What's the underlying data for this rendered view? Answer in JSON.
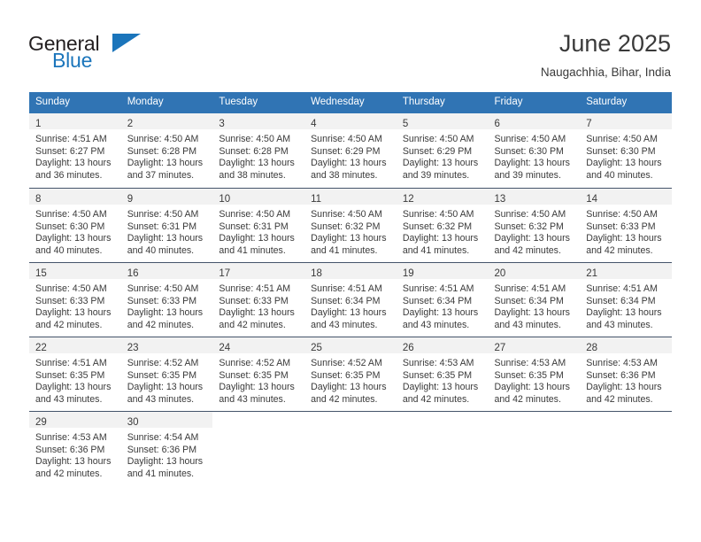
{
  "brand": {
    "name_part1": "General",
    "name_part2": "Blue",
    "accent_color": "#1b75bb"
  },
  "header": {
    "title": "June 2025",
    "subtitle": "Naugachhia, Bihar, India"
  },
  "theme": {
    "header_blue": "#3074b4",
    "day_band_gray": "#f2f2f2",
    "rule_color": "#44546a",
    "text_color": "#3a3a3a"
  },
  "calendar": {
    "columns": [
      "Sunday",
      "Monday",
      "Tuesday",
      "Wednesday",
      "Thursday",
      "Friday",
      "Saturday"
    ],
    "weeks": [
      [
        {
          "day": "1",
          "sunrise": "Sunrise: 4:51 AM",
          "sunset": "Sunset: 6:27 PM",
          "daylight1": "Daylight: 13 hours",
          "daylight2": "and 36 minutes."
        },
        {
          "day": "2",
          "sunrise": "Sunrise: 4:50 AM",
          "sunset": "Sunset: 6:28 PM",
          "daylight1": "Daylight: 13 hours",
          "daylight2": "and 37 minutes."
        },
        {
          "day": "3",
          "sunrise": "Sunrise: 4:50 AM",
          "sunset": "Sunset: 6:28 PM",
          "daylight1": "Daylight: 13 hours",
          "daylight2": "and 38 minutes."
        },
        {
          "day": "4",
          "sunrise": "Sunrise: 4:50 AM",
          "sunset": "Sunset: 6:29 PM",
          "daylight1": "Daylight: 13 hours",
          "daylight2": "and 38 minutes."
        },
        {
          "day": "5",
          "sunrise": "Sunrise: 4:50 AM",
          "sunset": "Sunset: 6:29 PM",
          "daylight1": "Daylight: 13 hours",
          "daylight2": "and 39 minutes."
        },
        {
          "day": "6",
          "sunrise": "Sunrise: 4:50 AM",
          "sunset": "Sunset: 6:30 PM",
          "daylight1": "Daylight: 13 hours",
          "daylight2": "and 39 minutes."
        },
        {
          "day": "7",
          "sunrise": "Sunrise: 4:50 AM",
          "sunset": "Sunset: 6:30 PM",
          "daylight1": "Daylight: 13 hours",
          "daylight2": "and 40 minutes."
        }
      ],
      [
        {
          "day": "8",
          "sunrise": "Sunrise: 4:50 AM",
          "sunset": "Sunset: 6:30 PM",
          "daylight1": "Daylight: 13 hours",
          "daylight2": "and 40 minutes."
        },
        {
          "day": "9",
          "sunrise": "Sunrise: 4:50 AM",
          "sunset": "Sunset: 6:31 PM",
          "daylight1": "Daylight: 13 hours",
          "daylight2": "and 40 minutes."
        },
        {
          "day": "10",
          "sunrise": "Sunrise: 4:50 AM",
          "sunset": "Sunset: 6:31 PM",
          "daylight1": "Daylight: 13 hours",
          "daylight2": "and 41 minutes."
        },
        {
          "day": "11",
          "sunrise": "Sunrise: 4:50 AM",
          "sunset": "Sunset: 6:32 PM",
          "daylight1": "Daylight: 13 hours",
          "daylight2": "and 41 minutes."
        },
        {
          "day": "12",
          "sunrise": "Sunrise: 4:50 AM",
          "sunset": "Sunset: 6:32 PM",
          "daylight1": "Daylight: 13 hours",
          "daylight2": "and 41 minutes."
        },
        {
          "day": "13",
          "sunrise": "Sunrise: 4:50 AM",
          "sunset": "Sunset: 6:32 PM",
          "daylight1": "Daylight: 13 hours",
          "daylight2": "and 42 minutes."
        },
        {
          "day": "14",
          "sunrise": "Sunrise: 4:50 AM",
          "sunset": "Sunset: 6:33 PM",
          "daylight1": "Daylight: 13 hours",
          "daylight2": "and 42 minutes."
        }
      ],
      [
        {
          "day": "15",
          "sunrise": "Sunrise: 4:50 AM",
          "sunset": "Sunset: 6:33 PM",
          "daylight1": "Daylight: 13 hours",
          "daylight2": "and 42 minutes."
        },
        {
          "day": "16",
          "sunrise": "Sunrise: 4:50 AM",
          "sunset": "Sunset: 6:33 PM",
          "daylight1": "Daylight: 13 hours",
          "daylight2": "and 42 minutes."
        },
        {
          "day": "17",
          "sunrise": "Sunrise: 4:51 AM",
          "sunset": "Sunset: 6:33 PM",
          "daylight1": "Daylight: 13 hours",
          "daylight2": "and 42 minutes."
        },
        {
          "day": "18",
          "sunrise": "Sunrise: 4:51 AM",
          "sunset": "Sunset: 6:34 PM",
          "daylight1": "Daylight: 13 hours",
          "daylight2": "and 43 minutes."
        },
        {
          "day": "19",
          "sunrise": "Sunrise: 4:51 AM",
          "sunset": "Sunset: 6:34 PM",
          "daylight1": "Daylight: 13 hours",
          "daylight2": "and 43 minutes."
        },
        {
          "day": "20",
          "sunrise": "Sunrise: 4:51 AM",
          "sunset": "Sunset: 6:34 PM",
          "daylight1": "Daylight: 13 hours",
          "daylight2": "and 43 minutes."
        },
        {
          "day": "21",
          "sunrise": "Sunrise: 4:51 AM",
          "sunset": "Sunset: 6:34 PM",
          "daylight1": "Daylight: 13 hours",
          "daylight2": "and 43 minutes."
        }
      ],
      [
        {
          "day": "22",
          "sunrise": "Sunrise: 4:51 AM",
          "sunset": "Sunset: 6:35 PM",
          "daylight1": "Daylight: 13 hours",
          "daylight2": "and 43 minutes."
        },
        {
          "day": "23",
          "sunrise": "Sunrise: 4:52 AM",
          "sunset": "Sunset: 6:35 PM",
          "daylight1": "Daylight: 13 hours",
          "daylight2": "and 43 minutes."
        },
        {
          "day": "24",
          "sunrise": "Sunrise: 4:52 AM",
          "sunset": "Sunset: 6:35 PM",
          "daylight1": "Daylight: 13 hours",
          "daylight2": "and 43 minutes."
        },
        {
          "day": "25",
          "sunrise": "Sunrise: 4:52 AM",
          "sunset": "Sunset: 6:35 PM",
          "daylight1": "Daylight: 13 hours",
          "daylight2": "and 42 minutes."
        },
        {
          "day": "26",
          "sunrise": "Sunrise: 4:53 AM",
          "sunset": "Sunset: 6:35 PM",
          "daylight1": "Daylight: 13 hours",
          "daylight2": "and 42 minutes."
        },
        {
          "day": "27",
          "sunrise": "Sunrise: 4:53 AM",
          "sunset": "Sunset: 6:35 PM",
          "daylight1": "Daylight: 13 hours",
          "daylight2": "and 42 minutes."
        },
        {
          "day": "28",
          "sunrise": "Sunrise: 4:53 AM",
          "sunset": "Sunset: 6:36 PM",
          "daylight1": "Daylight: 13 hours",
          "daylight2": "and 42 minutes."
        }
      ],
      [
        {
          "day": "29",
          "sunrise": "Sunrise: 4:53 AM",
          "sunset": "Sunset: 6:36 PM",
          "daylight1": "Daylight: 13 hours",
          "daylight2": "and 42 minutes."
        },
        {
          "day": "30",
          "sunrise": "Sunrise: 4:54 AM",
          "sunset": "Sunset: 6:36 PM",
          "daylight1": "Daylight: 13 hours",
          "daylight2": "and 41 minutes."
        },
        {
          "day": "",
          "sunrise": "",
          "sunset": "",
          "daylight1": "",
          "daylight2": ""
        },
        {
          "day": "",
          "sunrise": "",
          "sunset": "",
          "daylight1": "",
          "daylight2": ""
        },
        {
          "day": "",
          "sunrise": "",
          "sunset": "",
          "daylight1": "",
          "daylight2": ""
        },
        {
          "day": "",
          "sunrise": "",
          "sunset": "",
          "daylight1": "",
          "daylight2": ""
        },
        {
          "day": "",
          "sunrise": "",
          "sunset": "",
          "daylight1": "",
          "daylight2": ""
        }
      ]
    ]
  }
}
